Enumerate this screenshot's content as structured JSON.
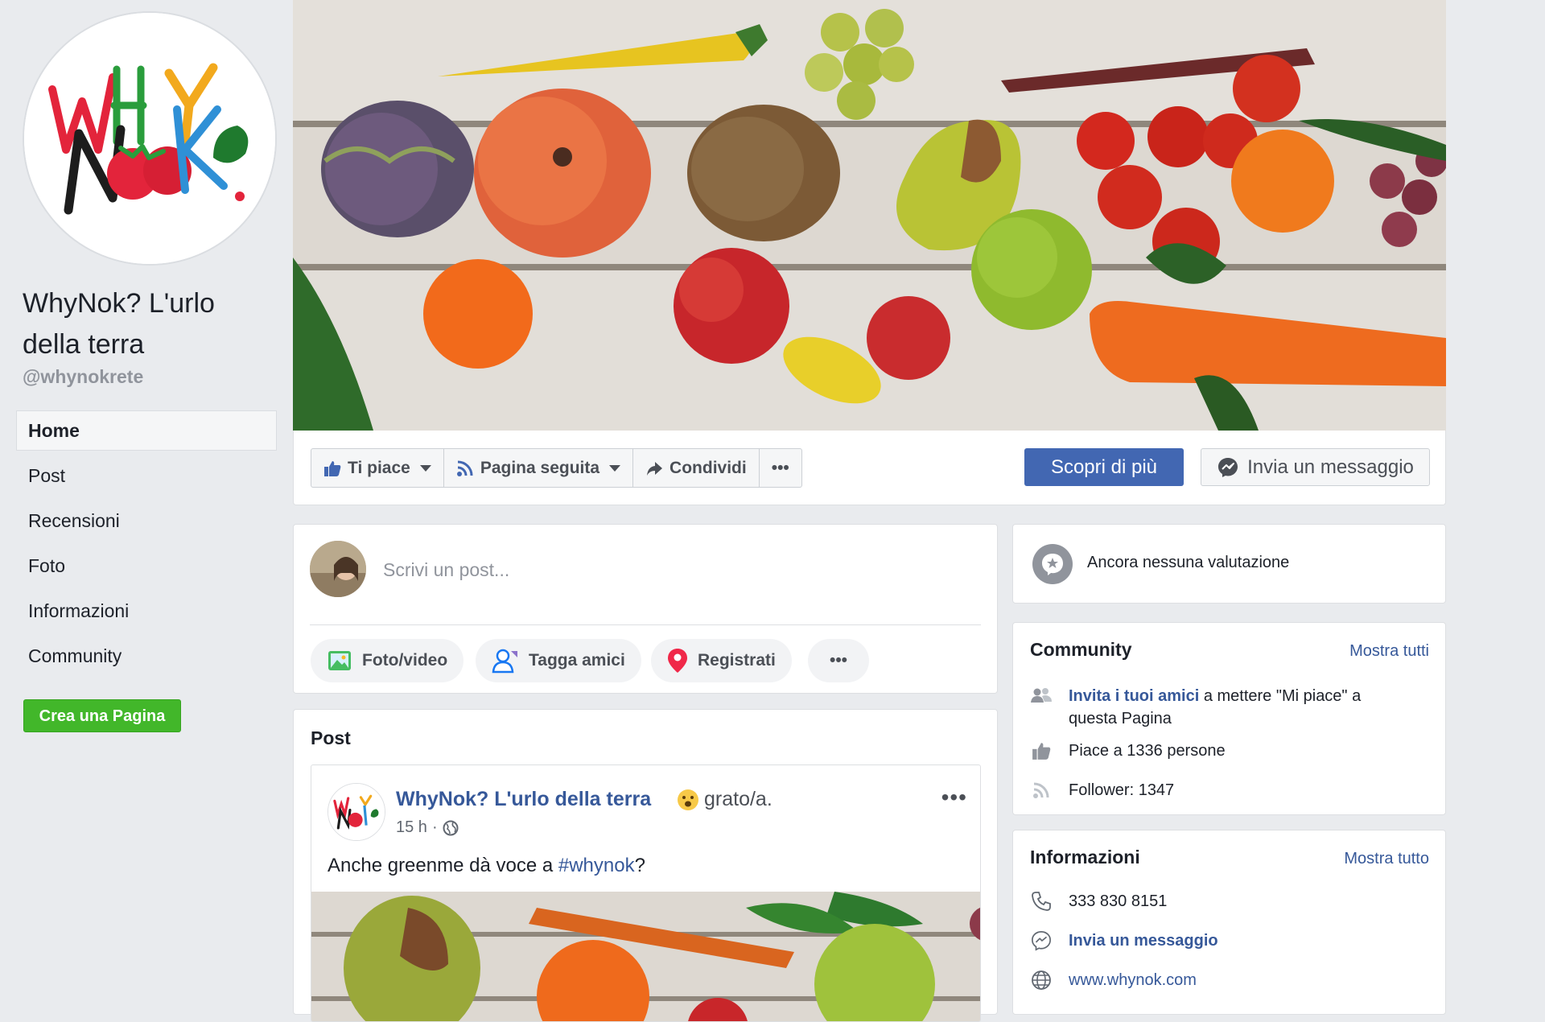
{
  "page": {
    "name": "WhyNok? L'urlo della terra",
    "handle": "@whynokrete"
  },
  "nav": {
    "items": [
      {
        "label": "Home",
        "active": true
      },
      {
        "label": "Post"
      },
      {
        "label": "Recensioni"
      },
      {
        "label": "Foto"
      },
      {
        "label": "Informazioni"
      },
      {
        "label": "Community"
      }
    ],
    "create_page": "Crea una Pagina"
  },
  "actions": {
    "like": "Ti piace",
    "follow": "Pagina seguita",
    "share": "Condividi",
    "more": "•••",
    "learn_more": "Scopri di più",
    "send_message": "Invia un messaggio"
  },
  "composer": {
    "placeholder": "Scrivi un post...",
    "buttons": {
      "photo": "Foto/video",
      "tag": "Tagga amici",
      "checkin": "Registrati",
      "more": "•••"
    }
  },
  "posts": {
    "title": "Post",
    "item": {
      "author": "WhyNok? L'urlo della terra",
      "feeling": "grato/a.",
      "time": "15 h",
      "text_prefix": "Anche greenme dà voce a ",
      "hashtag": "#whynok",
      "text_suffix": "?",
      "more": "•••"
    }
  },
  "rating": {
    "text": "Ancora nessuna valutazione"
  },
  "community": {
    "title": "Community",
    "link": "Mostra tutti",
    "invite_link": "Invita i tuoi amici",
    "invite_rest": " a mettere \"Mi piace\" a questa Pagina",
    "likes": "Piace a 1336 persone",
    "followers": "Follower: 1347"
  },
  "info": {
    "title": "Informazioni",
    "link": "Mostra tutto",
    "phone": "333 830 8151",
    "message": "Invia un messaggio",
    "website": "www.whynok.com"
  },
  "colors": {
    "fb_blue": "#4267b2",
    "link_blue": "#365899",
    "green": "#42b72a",
    "background": "#e9ebee"
  }
}
